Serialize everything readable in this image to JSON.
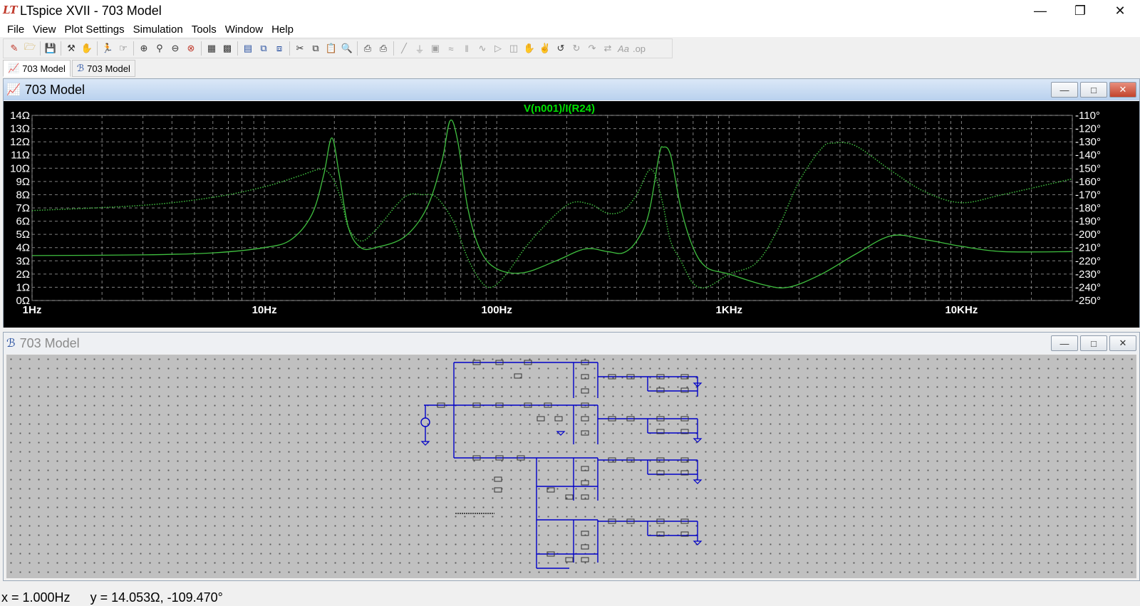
{
  "app": {
    "title": "LTspice XVII - 703 Model",
    "logo_text": "LT"
  },
  "window_controls": [
    "minimize-icon",
    "restore-icon",
    "close-icon"
  ],
  "menu": [
    "File",
    "View",
    "Plot Settings",
    "Simulation",
    "Tools",
    "Window",
    "Help"
  ],
  "toolbar": {
    "icons": [
      "new-schematic-icon",
      "open-icon",
      "save-icon",
      "control-panel-icon",
      "run-icon",
      "pan-icon",
      "zoom-in-icon",
      "zoom-area-icon",
      "zoom-out-icon",
      "zoom-cancel-icon",
      "autorange-icon",
      "tile-icon",
      "tile-horizontal-icon",
      "cascade-icon",
      "arrange-icon",
      "cut-icon",
      "copy-icon",
      "paste-icon",
      "find-icon",
      "print-icon",
      "print-preview-icon",
      "wire-icon",
      "ground-icon",
      "label-icon",
      "resistor-icon",
      "capacitor-icon",
      "inductor-icon",
      "diode-icon",
      "component-icon",
      "move-icon",
      "drag-icon",
      "undo-icon",
      "redo-icon",
      "rotate-icon",
      "mirror-icon",
      "text-icon",
      "spice-directive-icon"
    ]
  },
  "tabs": [
    {
      "label": "703 Model",
      "icon": "waveform-icon",
      "active": true
    },
    {
      "label": "703 Model",
      "icon": "schematic-icon",
      "active": false
    }
  ],
  "plot_window": {
    "title": "703 Model",
    "icon": "waveform-icon"
  },
  "schematic_window": {
    "title": "703 Model",
    "icon": "schematic-icon"
  },
  "colors": {
    "plot_background": "#000000",
    "trace": "#3fbf3f",
    "trace_title": "#00e000",
    "grid": "#808080",
    "schematic_wire": "#0000c8",
    "schematic_background": "#c0c0c0"
  },
  "chart_data": {
    "type": "line",
    "title": "V(n001)/I(R24)",
    "x_scale": "log",
    "xlim": [
      1,
      30000
    ],
    "x_ticks": [
      {
        "value": 1,
        "label": "1Hz"
      },
      {
        "value": 10,
        "label": "10Hz"
      },
      {
        "value": 100,
        "label": "100Hz"
      },
      {
        "value": 1000,
        "label": "1KHz"
      },
      {
        "value": 10000,
        "label": "10KHz"
      }
    ],
    "ylim_left": [
      0,
      14
    ],
    "y_ticks_left": [
      "0Ω",
      "1Ω",
      "2Ω",
      "3Ω",
      "4Ω",
      "5Ω",
      "6Ω",
      "7Ω",
      "8Ω",
      "9Ω",
      "10Ω",
      "11Ω",
      "12Ω",
      "13Ω",
      "14Ω"
    ],
    "ylim_right": [
      -250,
      -110
    ],
    "y_ticks_right": [
      "-250°",
      "-240°",
      "-230°",
      "-220°",
      "-210°",
      "-200°",
      "-190°",
      "-180°",
      "-170°",
      "-160°",
      "-150°",
      "-140°",
      "-130°",
      "-120°",
      "-110°"
    ],
    "grid": true,
    "series": [
      {
        "axis": "left",
        "style": "solid",
        "x": [
          1,
          3,
          6,
          10,
          13,
          16,
          18,
          19.5,
          21,
          23,
          26,
          30,
          40,
          50,
          58,
          63,
          68,
          75,
          85,
          100,
          130,
          180,
          240,
          300,
          350,
          400,
          450,
          500,
          520,
          560,
          620,
          700,
          800,
          1000,
          1400,
          1800,
          2500,
          3500,
          5000,
          7000,
          10000,
          15000,
          30000
        ],
        "y": [
          3.4,
          3.45,
          3.6,
          4.0,
          4.6,
          6.5,
          9.5,
          12.3,
          9.5,
          5.5,
          4.0,
          4.0,
          4.8,
          7.0,
          10.5,
          13.6,
          12.0,
          7.0,
          3.8,
          2.4,
          2.1,
          3.0,
          3.9,
          3.7,
          3.6,
          4.5,
          6.5,
          11.0,
          11.6,
          11.0,
          7.0,
          4.0,
          2.5,
          2.0,
          1.2,
          1.0,
          2.0,
          3.5,
          4.9,
          4.6,
          4.1,
          3.7,
          3.7
        ]
      },
      {
        "axis": "right",
        "style": "dotted",
        "x": [
          1,
          3,
          6,
          10,
          14,
          17,
          18.5,
          20,
          21.5,
          23,
          26,
          30,
          40,
          48,
          55,
          65,
          75,
          85,
          95,
          110,
          140,
          200,
          250,
          300,
          350,
          400,
          450,
          480,
          520,
          560,
          620,
          700,
          800,
          1000,
          1300,
          1600,
          2000,
          2500,
          2800,
          3500,
          5000,
          7000,
          10000,
          15000,
          30000
        ],
        "y": [
          -182,
          -178,
          -172,
          -164,
          -156,
          -151,
          -152,
          -160,
          -175,
          -195,
          -205,
          -197,
          -172,
          -170,
          -172,
          -190,
          -218,
          -235,
          -240,
          -230,
          -205,
          -178,
          -177,
          -184,
          -182,
          -170,
          -152,
          -155,
          -178,
          -205,
          -220,
          -237,
          -240,
          -230,
          -222,
          -198,
          -160,
          -135,
          -131,
          -133,
          -152,
          -168,
          -176,
          -170,
          -158
        ]
      }
    ]
  },
  "status": {
    "x_readout": "x = 1.000Hz",
    "y_readout": "y = 14.053Ω, -109.470°"
  }
}
